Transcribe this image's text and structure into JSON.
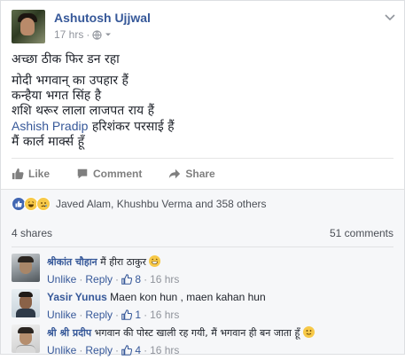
{
  "post": {
    "author": "Ashutosh Ujjwal",
    "time": "17 hrs",
    "privacy_icon": "globe-icon",
    "lines": [
      "अच्छा ठीक फिर डन रहा",
      "मोदी भगवान् का उपहार हैं",
      "कन्हैया भगत सिंह है",
      "शशि थरूर लाला लाजपत राय हैं"
    ],
    "mention": "Ashish Pradip",
    "mention_rest": " हरिशंकर परसाई हैं",
    "last_line": "मैं कार्ल मार्क्स हूँ"
  },
  "actions": {
    "like": "Like",
    "comment": "Comment",
    "share": "Share"
  },
  "reactions": {
    "summary": "Javed Alam, Khushbu Verma and 358 others"
  },
  "stats": {
    "shares": "4 shares",
    "comments": "51 comments"
  },
  "comments": [
    {
      "name": "श्रीकांत चौहान",
      "text": " मैं हीरा ठाकुर ",
      "unlike": "Unlike",
      "reply": "Reply",
      "likes": "8",
      "time": "16 hrs"
    },
    {
      "name": "Yasir Yunus",
      "text": " Maen kon hun , maen kahan hun",
      "unlike": "Unlike",
      "reply": "Reply",
      "likes": "1",
      "time": "16 hrs"
    },
    {
      "name": "श्री श्री प्रदीप",
      "text": " भगवान की पोस्ट खाली रह गयी, मैं भगवान ही बन जाता हूँ ",
      "unlike": "Unlike",
      "reply": "Reply",
      "likes": "4",
      "time": "16 hrs"
    }
  ],
  "colors": {
    "link": "#365899",
    "muted": "#90949c",
    "like_blue": "#4267b2"
  }
}
